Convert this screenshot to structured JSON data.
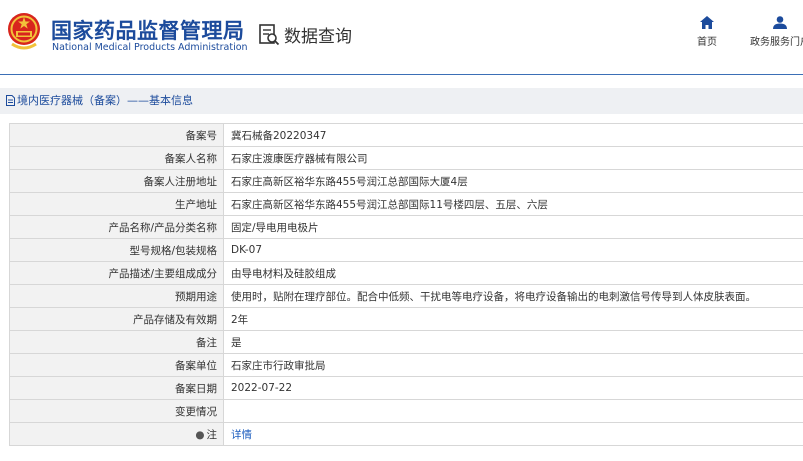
{
  "header": {
    "org_name_cn": "国家药品监督管理局",
    "org_name_en": "National Medical Products Administration",
    "query_label": "数据查询",
    "nav": {
      "home": "首页",
      "portal": "政务服务门户"
    }
  },
  "breadcrumb": "境内医疗器械（备案）——基本信息",
  "rows": [
    {
      "key": "备案号",
      "value": "冀石械备20220347"
    },
    {
      "key": "备案人名称",
      "value": "石家庄渡康医疗器械有限公司"
    },
    {
      "key": "备案人注册地址",
      "value": "石家庄高新区裕华东路455号润江总部国际大厦4层"
    },
    {
      "key": "生产地址",
      "value": "石家庄高新区裕华东路455号润江总部国际11号楼四层、五层、六层"
    },
    {
      "key": "产品名称/产品分类名称",
      "value": "固定/导电用电极片"
    },
    {
      "key": "型号规格/包装规格",
      "value": "DK-07"
    },
    {
      "key": "产品描述/主要组成成分",
      "value": "由导电材料及硅胶组成"
    },
    {
      "key": "预期用途",
      "value": "使用时，贴附在理疗部位。配合中低频、干扰电等电疗设备，将电疗设备输出的电刺激信号传导到人体皮肤表面。"
    },
    {
      "key": "产品存储及有效期",
      "value": "2年"
    },
    {
      "key": "备注",
      "value": "是"
    },
    {
      "key": "备案单位",
      "value": "石家庄市行政审批局"
    },
    {
      "key": "备案日期",
      "value": "2022-07-22"
    },
    {
      "key": "变更情况",
      "value": ""
    },
    {
      "key": "注",
      "value": "详情"
    }
  ]
}
